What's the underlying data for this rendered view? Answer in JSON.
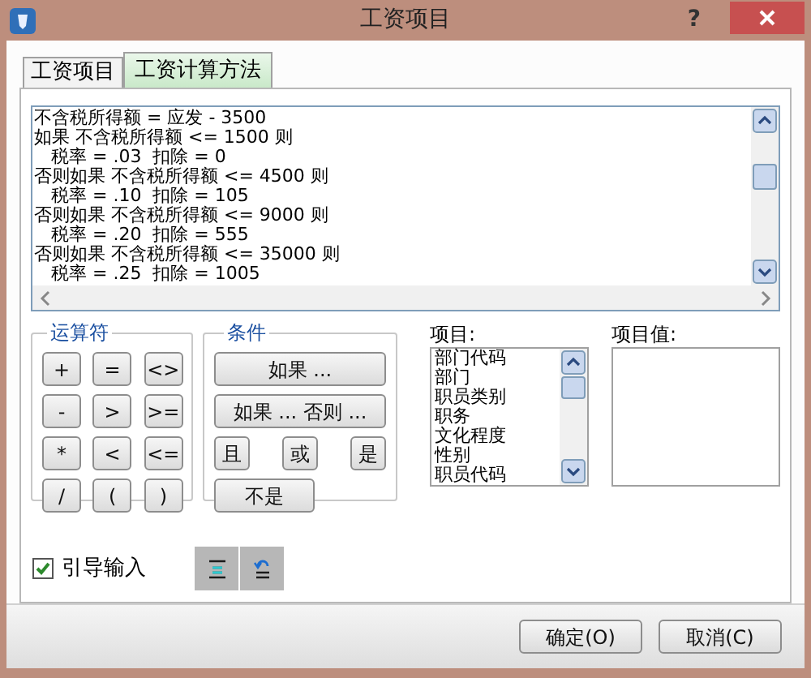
{
  "window": {
    "title": "工资项目",
    "help": "?"
  },
  "tabs": [
    {
      "label": "工资项目",
      "selected": false
    },
    {
      "label": "工资计算方法",
      "selected": true
    }
  ],
  "formula": {
    "lines": [
      "不含税所得额 = 应发 - 3500",
      "如果 不含税所得额 <= 1500 则",
      "   税率 = .03  扣除 = 0",
      "否则如果 不含税所得额 <= 4500 则",
      "   税率 = .10  扣除 = 105",
      "否则如果 不含税所得额 <= 9000 则",
      "   税率 = .20  扣除 = 555",
      "否则如果 不含税所得额 <= 35000 则",
      "   税率 = .25  扣除 = 1005"
    ]
  },
  "operators": {
    "title": "运算符",
    "buttons": [
      "+",
      "=",
      "<>",
      "-",
      ">",
      ">=",
      "*",
      "<",
      "<=",
      "/",
      "(",
      ")"
    ]
  },
  "conditions": {
    "title": "条件",
    "buttons": [
      {
        "label": "如果 ...",
        "kind": "wide"
      },
      {
        "label": "如果 ... 否则 ...",
        "kind": "wide"
      },
      {
        "label": "且",
        "kind": "small"
      },
      {
        "label": "或",
        "kind": "small"
      },
      {
        "label": "是",
        "kind": "small"
      },
      {
        "label": "不是",
        "kind": "medium"
      }
    ]
  },
  "items": {
    "label": "项目:",
    "list": [
      "部门代码",
      "部门",
      "职员类别",
      "职务",
      "文化程度",
      "性别",
      "职员代码"
    ]
  },
  "item_values": {
    "label": "项目值:"
  },
  "guided_input": {
    "label": "引导输入",
    "checked": true
  },
  "footer_buttons": [
    "确定(O)",
    "取消(C)"
  ]
}
